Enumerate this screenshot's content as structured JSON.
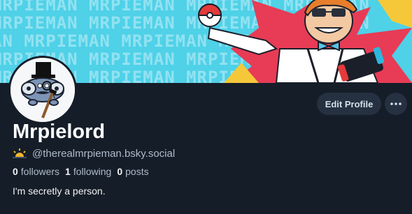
{
  "banner": {
    "text_lines": [
      "MRPIEMAN MRPIEMAN MRPIEMAN MRPIEMAN",
      "MRPIEMAN MRPIEMAN MRPIEMAN MRPIEMAN",
      "AN MRPIEMAN MRPIEMAN MRPIEMAN MRPIE",
      "MRPIEMAN MRPIEMAN MRPIEMAN MRPIEMAN",
      "MRPIEMAN MRPIEMAN MRPIEMAN MRPIEMAN"
    ]
  },
  "profile": {
    "display_name": "Mrpielord",
    "handle": "@therealmrpieman.bsky.social",
    "handle_icon": "sun-icon",
    "followers_count": "0",
    "followers_label": "followers",
    "following_count": "1",
    "following_label": "following",
    "posts_count": "0",
    "posts_label": "posts",
    "bio": "I'm secretly a person."
  },
  "actions": {
    "edit_profile_label": "Edit Profile",
    "more_icon": "ellipsis-icon"
  },
  "colors": {
    "background": "#151d28",
    "banner": "#4fd1e8",
    "button": "#253140",
    "muted_text": "#aebbc9"
  }
}
